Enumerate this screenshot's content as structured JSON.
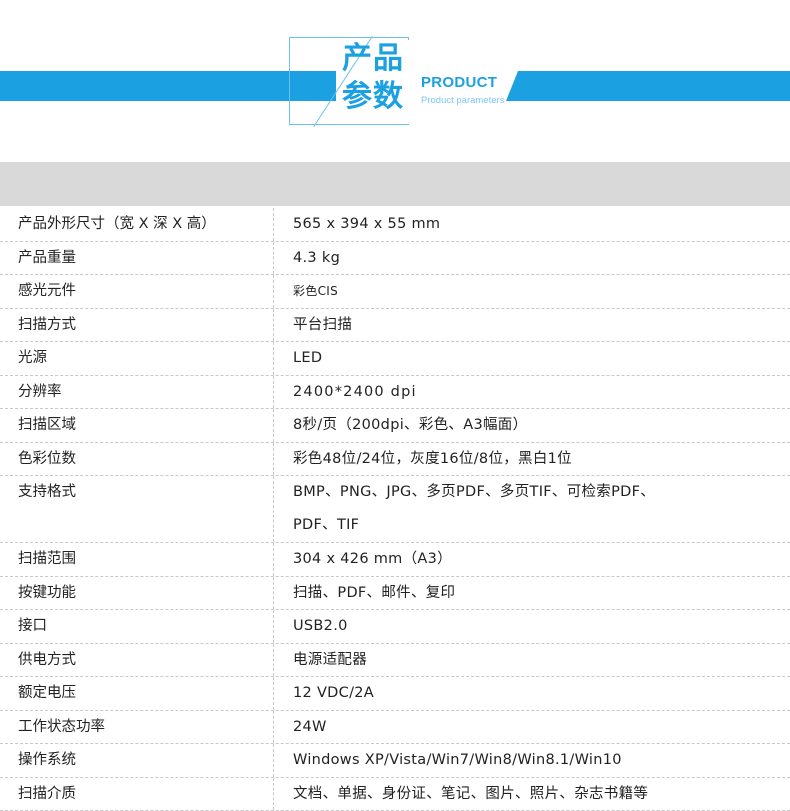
{
  "header": {
    "title_cn_line1": "产品",
    "title_cn_line2": "参数",
    "title_en": "PRODUCT",
    "subtitle_en": "Product parameters",
    "accent_color": "#1ba1e2"
  },
  "specs": [
    {
      "label": "产品外形尺寸（宽 X 深 X 高）",
      "value": "565 x 394 x 55 mm"
    },
    {
      "label": "产品重量",
      "value": "4.3 kg"
    },
    {
      "label": "感光元件",
      "value": "彩色CIS"
    },
    {
      "label": "扫描方式",
      "value": "平台扫描"
    },
    {
      "label": "光源",
      "value": "LED"
    },
    {
      "label": "分辨率",
      "value": "2400*2400 dpi"
    },
    {
      "label": "扫描区域",
      "value": "8秒/页（200dpi、彩色、A3幅面）"
    },
    {
      "label": "色彩位数",
      "value": "彩色48位/24位，灰度16位/8位，黑白1位"
    },
    {
      "label": "支持格式",
      "value": "BMP、PNG、JPG、多页PDF、多页TIF、可检索PDF、\nPDF、TIF"
    },
    {
      "label": "扫描范围",
      "value": "304 x 426 mm（A3）"
    },
    {
      "label": "按键功能",
      "value": "扫描、PDF、邮件、复印"
    },
    {
      "label": "接口",
      "value": "USB2.0"
    },
    {
      "label": "供电方式",
      "value": "电源适配器"
    },
    {
      "label": "额定电压",
      "value": "12 VDC/2A"
    },
    {
      "label": "工作状态功率",
      "value": "24W"
    },
    {
      "label": "操作系统",
      "value": "Windows XP/Vista/Win7/Win8/Win8.1/Win10"
    },
    {
      "label": "扫描介质",
      "value": "文档、单据、身份证、笔记、图片、照片、杂志书籍等"
    }
  ]
}
